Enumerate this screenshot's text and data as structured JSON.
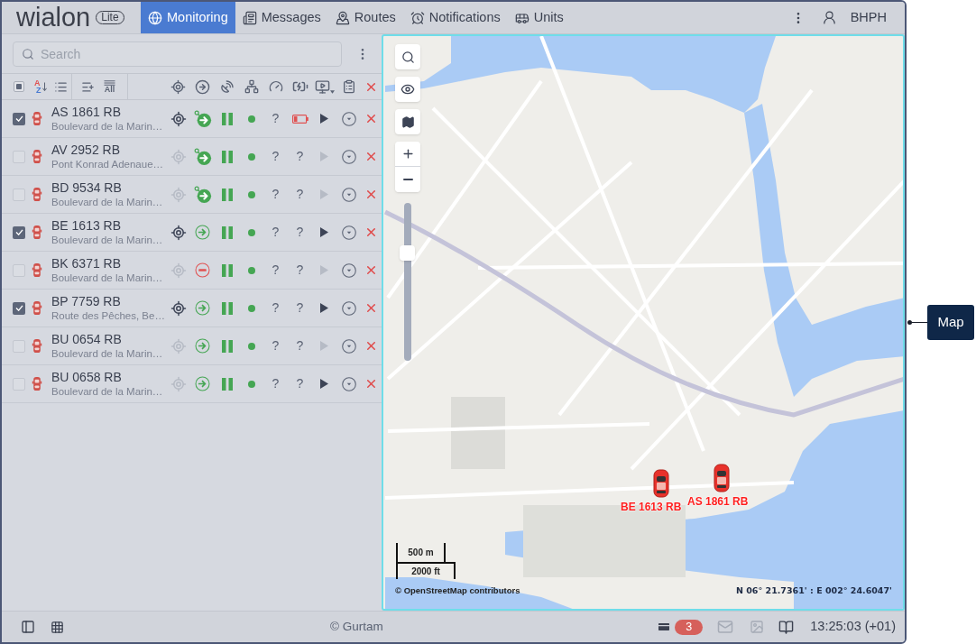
{
  "app": {
    "logo": "wialon",
    "edition": "Lite"
  },
  "nav_tabs": [
    {
      "label": "Monitoring",
      "selected": true
    },
    {
      "label": "Messages",
      "selected": false
    },
    {
      "label": "Routes",
      "selected": false
    },
    {
      "label": "Notifications",
      "selected": false
    },
    {
      "label": "Units",
      "selected": false
    }
  ],
  "user": {
    "name": "BHPH"
  },
  "search": {
    "placeholder": "Search"
  },
  "list_toolbar": {
    "select_all_partial": true,
    "sort_letters": [
      "A",
      "Z"
    ],
    "all_label": "All"
  },
  "units": [
    {
      "name": "AS 1861 RB",
      "address": "Boulevard de la Marin…",
      "checked": true,
      "motion": {
        "kind": "moving_new"
      },
      "speed": "?",
      "power": {
        "kind": "battery_low"
      },
      "video": true
    },
    {
      "name": "AV 2952 RB",
      "address": "Pont Konrad Adenaue…",
      "checked": false,
      "motion": {
        "kind": "moving_new"
      },
      "speed": "?",
      "power": {
        "kind": "text",
        "text": "?"
      },
      "video": false
    },
    {
      "name": "BD 9534 RB",
      "address": "Boulevard de la Marin…",
      "checked": false,
      "motion": {
        "kind": "moving_new"
      },
      "speed": "?",
      "power": {
        "kind": "text",
        "text": "?"
      },
      "video": false
    },
    {
      "name": "BE 1613 RB",
      "address": "Boulevard de la Marin…",
      "checked": true,
      "motion": {
        "kind": "moving"
      },
      "speed": "?",
      "power": {
        "kind": "text",
        "text": "?"
      },
      "video": true
    },
    {
      "name": "BK 6371 RB",
      "address": "Boulevard de la Marin…",
      "checked": false,
      "motion": {
        "kind": "stopped"
      },
      "speed": "?",
      "power": {
        "kind": "text",
        "text": "?"
      },
      "video": false
    },
    {
      "name": "BP 7759 RB",
      "address": "Route des Pêches, Be…",
      "checked": true,
      "motion": {
        "kind": "moving"
      },
      "speed": "?",
      "power": {
        "kind": "text",
        "text": "?"
      },
      "video": true
    },
    {
      "name": "BU 0654 RB",
      "address": "Boulevard de la Marin…",
      "checked": false,
      "motion": {
        "kind": "moving"
      },
      "speed": "?",
      "power": {
        "kind": "text",
        "text": "?"
      },
      "video": false
    },
    {
      "name": "BU 0658 RB",
      "address": "Boulevard de la Marin…",
      "checked": false,
      "motion": {
        "kind": "moving"
      },
      "speed": "?",
      "power": {
        "kind": "text",
        "text": "?"
      },
      "video": true
    }
  ],
  "map": {
    "zoom": {
      "level": 0.7
    },
    "markers": [
      {
        "label": "BE 1613 RB"
      },
      {
        "label": "AS 1861 RB"
      }
    ],
    "scale": [
      "500 m",
      "2000 ft"
    ],
    "attribution": "© OpenStreetMap contributors",
    "coordinates": "N 06° 21.7361' : E 002° 24.6047'"
  },
  "status_bar": {
    "copyright": "© Gurtam",
    "badge": "3",
    "time": "13:25:03 (+01)"
  },
  "callout": {
    "label": "Map"
  }
}
